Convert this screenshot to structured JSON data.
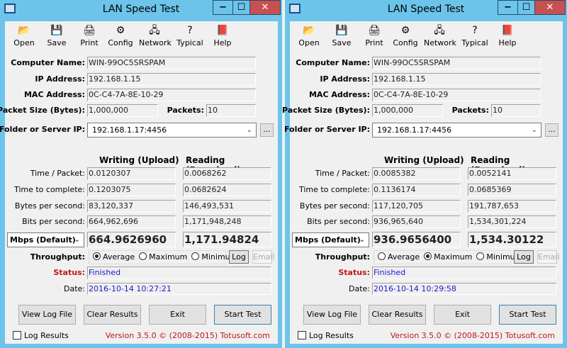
{
  "app_title": "LAN Speed Test",
  "toolbar": [
    {
      "label": "Open",
      "icon": "folder-open-icon",
      "glyph": "📂"
    },
    {
      "label": "Save",
      "icon": "floppy-disk-icon",
      "glyph": "💾"
    },
    {
      "label": "Print",
      "icon": "printer-icon",
      "glyph": "🖨"
    },
    {
      "label": "Config",
      "icon": "config-icon",
      "glyph": "⚙"
    },
    {
      "label": "Network",
      "icon": "network-icon",
      "glyph": "🖧"
    },
    {
      "label": "Typical",
      "icon": "question-icon",
      "glyph": "?"
    },
    {
      "label": "Help",
      "icon": "help-book-icon",
      "glyph": "📕"
    }
  ],
  "labels": {
    "computer_name": "Computer Name:",
    "ip_address": "IP Address:",
    "mac_address": "MAC Address:",
    "packet_size": "Packet Size (Bytes):",
    "packets": "Packets:",
    "folder": "Folder or Server IP:",
    "browse": "...",
    "writing": "Writing (Upload)",
    "reading": "Reading (Download)",
    "rows": [
      "Time / Packet:",
      "Time to complete:",
      "Bytes per second:",
      "Bits per second:"
    ],
    "throughput": "Throughput:",
    "average": "Average",
    "maximum": "Maximum",
    "minimum": "Minimum",
    "log": "Log",
    "email": "Email",
    "status": "Status:",
    "date": "Date:",
    "view_log": "View Log File",
    "clear": "Clear Results",
    "exit": "Exit",
    "start": "Start Test",
    "log_results": "Log Results",
    "version": "Version 3.5.0  © (2008-2015) Totusoft.com"
  },
  "windows": [
    {
      "computer_name": "WIN-99OC5SRSPAM",
      "ip": "192.168.1.15",
      "mac": "0C-C4-7A-8E-10-29",
      "packet_size": "1,000,000",
      "packets": "10",
      "server": "192.168.1.17:4456",
      "write": [
        "0.0120307",
        "0.1203075",
        "83,120,337",
        "664,962,696"
      ],
      "read": [
        "0.0068262",
        "0.0682624",
        "146,493,531",
        "1,171,948,248"
      ],
      "unit": "Mbps (Default)",
      "write_mbps": "664.9626960",
      "read_mbps": "1,171.94824",
      "throughput_selected": "average",
      "status": "Finished",
      "date": "2016-10-14 10:27:21"
    },
    {
      "computer_name": "WIN-99OC5SRSPAM",
      "ip": "192.168.1.15",
      "mac": "0C-C4-7A-8E-10-29",
      "packet_size": "1,000,000",
      "packets": "10",
      "server": "192.168.1.17:4456",
      "write": [
        "0.0085382",
        "0.1136174",
        "117,120,705",
        "936,965,640"
      ],
      "read": [
        "0.0052141",
        "0.0685369",
        "191,787,653",
        "1,534,301,224"
      ],
      "unit": "Mbps (Default)",
      "write_mbps": "936.9656400",
      "read_mbps": "1,534.30122",
      "throughput_selected": "maximum",
      "status": "Finished",
      "date": "2016-10-14 10:29:58"
    }
  ]
}
